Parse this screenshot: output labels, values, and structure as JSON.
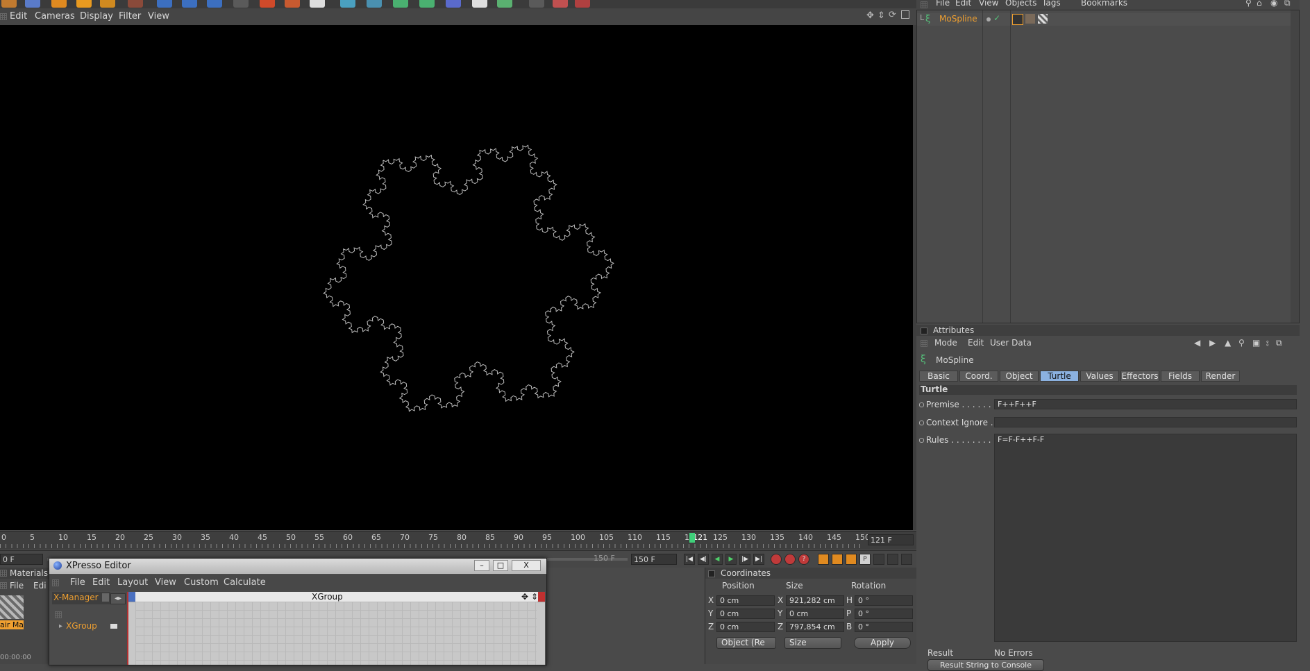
{
  "viewport": {
    "menu": [
      "Edit",
      "Cameras",
      "Display",
      "Filter",
      "View"
    ]
  },
  "timeline": {
    "ticks": [
      "0",
      "5",
      "10",
      "15",
      "20",
      "25",
      "30",
      "35",
      "40",
      "45",
      "50",
      "55",
      "60",
      "65",
      "70",
      "75",
      "80",
      "85",
      "90",
      "95",
      "100",
      "105",
      "110",
      "115",
      "12",
      "121",
      "125",
      "130",
      "135",
      "140",
      "145",
      "150"
    ],
    "current_frame_field": "121 F",
    "start_field": "0 F",
    "end_field_dim": "150 F",
    "end_field": "150 F"
  },
  "materials": {
    "tab": "Materials",
    "menu": [
      "File",
      "Edi"
    ],
    "thumb_label": "air Ma",
    "time": "00:00:00"
  },
  "xpresso": {
    "title": "XPresso Editor",
    "menu": [
      "File",
      "Edit",
      "Layout",
      "View",
      "Custom",
      "Calculate"
    ],
    "manager_tab": "X-Manager",
    "tree_item": "XGroup",
    "canvas_title": "XGroup",
    "win_min": "–",
    "win_max": "□",
    "win_close": "X"
  },
  "objects": {
    "menu": [
      "File",
      "Edit",
      "View",
      "Objects",
      "Tags",
      "Bookmarks"
    ],
    "item": "MoSpline"
  },
  "attributes": {
    "header": "Attributes",
    "menu": [
      "Mode",
      "Edit",
      "User Data"
    ],
    "object_name": "MoSpline",
    "tabs": [
      "Basic",
      "Coord.",
      "Object",
      "Turtle",
      "Values",
      "Effectors",
      "Fields",
      "Render"
    ],
    "active_tab": "Turtle",
    "section": "Turtle",
    "premise_label": "Premise . . . . . . .",
    "premise_value": "F++F++F",
    "context_label": "Context Ignore . .",
    "context_value": "",
    "rules_label": "Rules . . . . . . . . .",
    "rules_value": "F=F-F++F-F",
    "result_label": "Result",
    "result_value": "No Errors",
    "result_button": "Result String to Console"
  },
  "coordinates": {
    "header": "Coordinates",
    "col_position": "Position",
    "col_size": "Size",
    "col_rotation": "Rotation",
    "rows": [
      {
        "axis": "X",
        "pos": "0 cm",
        "saxis": "X",
        "size": "921,282 cm",
        "raxis": "H",
        "rot": "0 °"
      },
      {
        "axis": "Y",
        "pos": "0 cm",
        "saxis": "Y",
        "size": "0 cm",
        "raxis": "P",
        "rot": "0 °"
      },
      {
        "axis": "Z",
        "pos": "0 cm",
        "saxis": "Z",
        "size": "797,854 cm",
        "raxis": "B",
        "rot": "0 °"
      }
    ],
    "mode_select": "Object (Re",
    "size_select": "Size",
    "apply": "Apply"
  },
  "colors": {
    "accent_orange": "#f0a030",
    "active_tab": "#8bb1e0",
    "viewport_bg": "#000000",
    "spline": "#bdbdbd"
  },
  "icons": [
    "grip-icon",
    "mospline-icon",
    "play-icon",
    "record-icon",
    "close-icon"
  ]
}
